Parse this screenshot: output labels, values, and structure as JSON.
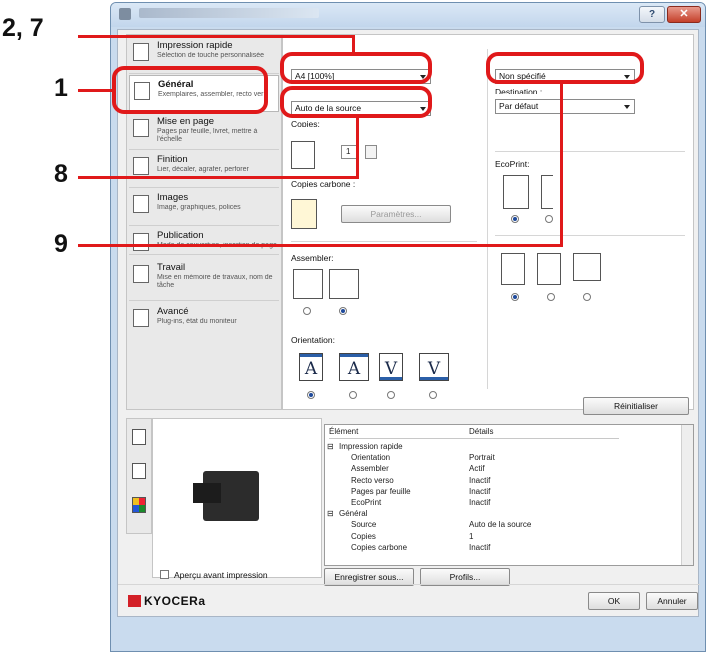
{
  "window": {
    "close_glyph": "✕",
    "help_glyph": "?"
  },
  "sidebar": {
    "items": [
      {
        "name": "Impression rapide",
        "desc": "Sélection de touche personnalisée"
      },
      {
        "name": "Général",
        "desc": "Exemplaires, assembler, recto ver"
      },
      {
        "name": "Mise en page",
        "desc": "Pages par feuille, livret, mettre à l'échelle"
      },
      {
        "name": "Finition",
        "desc": "Lier, décaler, agrafer, perforer"
      },
      {
        "name": "Images",
        "desc": "Image, graphiques, polices"
      },
      {
        "name": "Publication",
        "desc": "Mode de couverture, insertion de page"
      },
      {
        "name": "Travail",
        "desc": "Mise en mémoire de travaux, nom de tâche"
      },
      {
        "name": "Avancé",
        "desc": "Plug-ins, état du moniteur"
      }
    ]
  },
  "general": {
    "paper_size": "A4 [100%]",
    "source": "Auto de la source",
    "copies_label": "Copies:",
    "copies_value": "1",
    "carbon_label": "Copies carbone :",
    "settings_button": "Paramètres...",
    "collate_label": "Assembler:",
    "orientation_label": "Orientation:",
    "media_type": "Non spécifié",
    "destination_label": "Destination :",
    "destination": "Par défaut",
    "ecoprint_label": "EcoPrint:",
    "reset_button": "Réinitialiser"
  },
  "summary": {
    "headers": [
      "Élément",
      "Détails"
    ],
    "rows": [
      {
        "item": "Impression rapide",
        "detail": "",
        "group": true
      },
      {
        "item": "Orientation",
        "detail": "Portrait",
        "group": false
      },
      {
        "item": "Assembler",
        "detail": "Actif",
        "group": false
      },
      {
        "item": "Recto verso",
        "detail": "Inactif",
        "group": false
      },
      {
        "item": "Pages par feuille",
        "detail": "Inactif",
        "group": false
      },
      {
        "item": "EcoPrint",
        "detail": "Inactif",
        "group": false
      },
      {
        "item": "Général",
        "detail": "",
        "group": true
      },
      {
        "item": "Source",
        "detail": "Auto de la source",
        "group": false
      },
      {
        "item": "Copies",
        "detail": "1",
        "group": false
      },
      {
        "item": "Copies carbone",
        "detail": "Inactif",
        "group": false
      }
    ]
  },
  "footer": {
    "preview_checkbox": "Aperçu avant impression",
    "save_button": "Enregistrer sous...",
    "profiles_button": "Profils...",
    "brand": "KYOCERa",
    "ok_button": "OK",
    "cancel_button": "Annuler"
  },
  "callouts": {
    "c27": "2, 7",
    "c1": "1",
    "c8": "8",
    "c9": "9"
  },
  "colors": {
    "callout": "#e0191a",
    "brand": "#d32027"
  }
}
